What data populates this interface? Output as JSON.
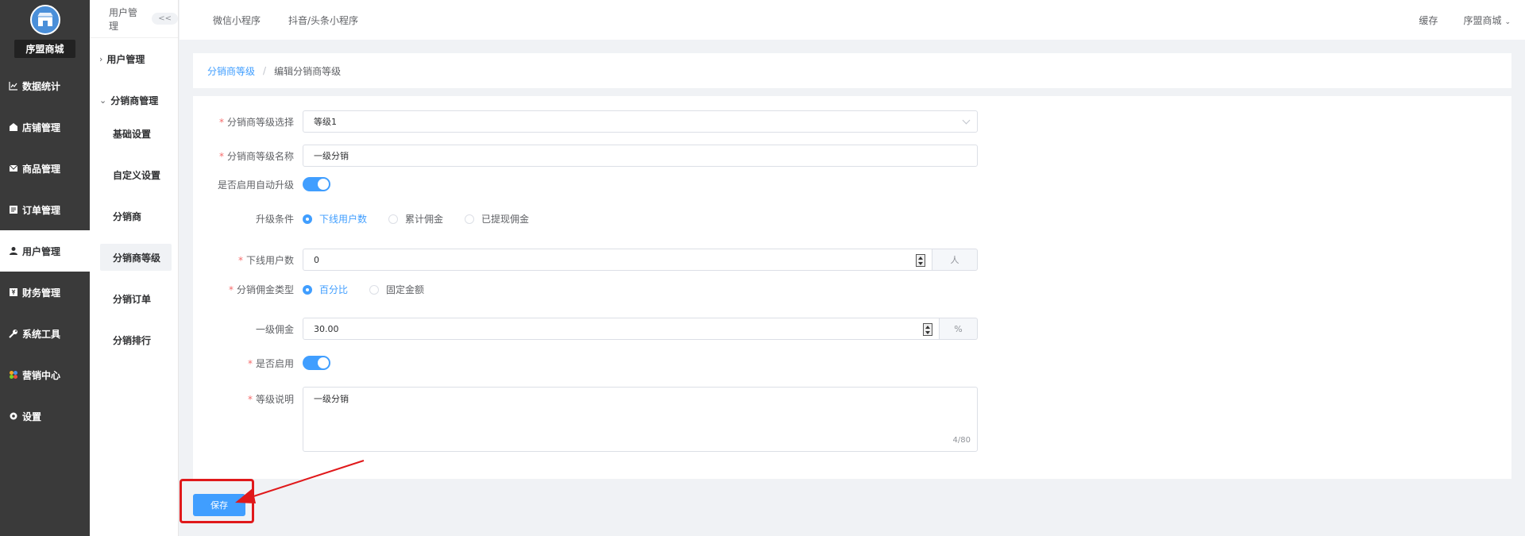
{
  "brand": {
    "shop_name": "序盟商城"
  },
  "main_nav": [
    {
      "label": "数据统计",
      "icon": "chart-line-icon"
    },
    {
      "label": "店铺管理",
      "icon": "store-icon"
    },
    {
      "label": "商品管理",
      "icon": "mail-icon"
    },
    {
      "label": "订单管理",
      "icon": "order-icon"
    },
    {
      "label": "用户管理",
      "icon": "user-icon",
      "active": true
    },
    {
      "label": "财务管理",
      "icon": "finance-icon"
    },
    {
      "label": "系统工具",
      "icon": "wrench-icon"
    },
    {
      "label": "营销中心",
      "icon": "marketing-icon"
    },
    {
      "label": "设置",
      "icon": "gear-icon"
    }
  ],
  "sub_nav": {
    "title": "用户管理",
    "collapse": "<<",
    "group_user": "用户管理",
    "group_distribution": "分销商管理",
    "items": [
      "基础设置",
      "自定义设置",
      "分销商",
      "分销商等级",
      "分销订单",
      "分销排行"
    ],
    "active_index": 3
  },
  "header": {
    "tabs": [
      "微信小程序",
      "抖音/头条小程序"
    ],
    "cache": "缓存",
    "user": "序盟商城"
  },
  "breadcrumb": {
    "parent": "分销商等级",
    "separator": "/",
    "current": "编辑分销商等级"
  },
  "form": {
    "level_select": {
      "label": "分销商等级选择",
      "value": "等级1"
    },
    "level_name": {
      "label": "分销商等级名称",
      "value": "一级分销"
    },
    "auto_upgrade": {
      "label": "是否启用自动升级",
      "enabled": true
    },
    "upgrade_condition": {
      "label": "升级条件",
      "options": [
        "下线用户数",
        "累计佣金",
        "已提现佣金"
      ],
      "selected": 0
    },
    "downline_users": {
      "label": "下线用户数",
      "value": "0",
      "unit": "人"
    },
    "commission_type": {
      "label": "分销佣金类型",
      "options": [
        "百分比",
        "固定金额"
      ],
      "selected": 0
    },
    "first_commission": {
      "label": "一级佣金",
      "value": "30.00",
      "unit": "%"
    },
    "enabled": {
      "label": "是否启用",
      "enabled": true
    },
    "description": {
      "label": "等级说明",
      "value": "一级分销",
      "counter": "4/80"
    },
    "save": "保存"
  },
  "colors": {
    "primary": "#409eff",
    "sidebar": "#3a3a3a",
    "annotation": "#e0191b"
  }
}
